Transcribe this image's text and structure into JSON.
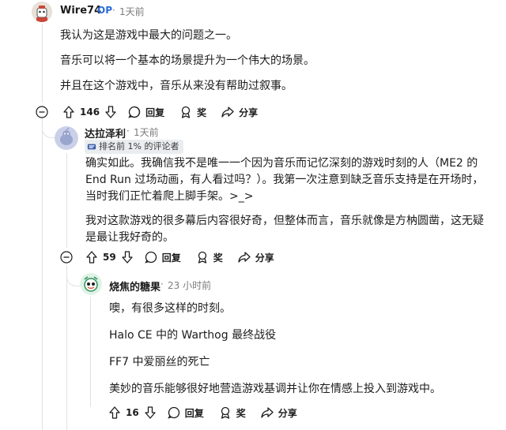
{
  "comments": [
    {
      "username": "Wire74",
      "op_badge": "OP",
      "dot": "·",
      "time": "1天前",
      "paragraphs": [
        "我认为这是游戏中最大的问题之一。",
        "音乐可以将一个基本的场景提升为一个伟大的场景。",
        "并且在这个游戏中，音乐从来没有帮助过叙事。"
      ],
      "votes": "146",
      "reply_label": "回复",
      "award_label": "奖",
      "share_label": "分享"
    },
    {
      "username": "达拉泽利",
      "dot": "·",
      "time": "1天前",
      "flair": "排名前 1% 的评论者",
      "paragraphs": [
        "确实如此。我确信我不是唯一一个因为音乐而记忆深刻的游戏时刻的人（ME2 的 End Run 过场动画，有人看过吗？）。我第一次注意到缺乏音乐支持是在开场时，当时我们正忙着爬上脚手架。>_>",
        "我对这款游戏的很多幕后内容很好奇，但整体而言，音乐就像是方枘圆凿，这无疑是最让我好奇的。"
      ],
      "votes": "59",
      "reply_label": "回复",
      "award_label": "奖",
      "share_label": "分享"
    },
    {
      "username": "烧焦的糖果",
      "dot": "·",
      "time": "23 小时前",
      "paragraphs": [
        "噢，有很多这样的时刻。",
        "Halo CE 中的 Warthog 最终战役",
        "FF7 中爱丽丝的死亡",
        "美妙的音乐能够很好地营造游戏基调并让你在情感上投入到游戏中。"
      ],
      "votes": "16",
      "reply_label": "回复",
      "award_label": "奖",
      "share_label": "分享"
    }
  ],
  "colors": {
    "op_badge": "#2b6cd8",
    "meta": "#7c7c7c",
    "thread_line": "#dfe1e3"
  },
  "icons": [
    "avatar-wire74",
    "avatar-dalazeli",
    "avatar-candy",
    "collapse-icon",
    "upvote-icon",
    "downvote-icon",
    "comment-icon",
    "award-icon",
    "share-icon",
    "flair-icon"
  ]
}
